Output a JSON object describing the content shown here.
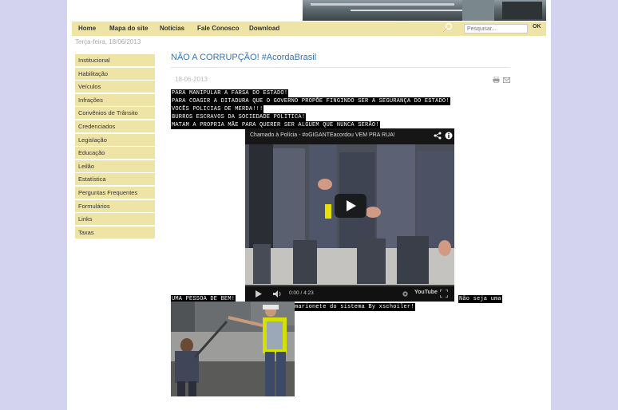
{
  "nav": {
    "items": [
      "Home",
      "Mapa do site",
      "Notícias",
      "Fale Conosco",
      "Download"
    ],
    "search_placeholder": "Pesquisar...",
    "ok_label": "OK"
  },
  "date_line": "Terça-feira, 18/06/2013",
  "sidebar": {
    "items": [
      "Institucional",
      "Habilitação",
      "Veículos",
      "Infrações",
      "Convênios de Trânsito",
      "Credenciados",
      "Legislação",
      "Educação",
      "Leilão",
      "Estatística",
      "Perguntas Frequentes",
      "Formulários",
      "Links",
      "Taxas"
    ]
  },
  "article": {
    "title": "NÃO A CORRUPÇÃO! #AcordaBrasil",
    "date": "18-06-2013",
    "lines": [
      "PARA MANIPULAR A FARSA DO ESTADO!",
      "PARA COAGIR A DITADURA QUE O GOVERNO PROPÕE FINGINDO SER A SEGURANÇA DO ESTADO!",
      "VOCÊS POLICIAS DE MERDA!!!",
      "BURROS ESCRAVOS DA SOCIEDADE POLITICA!",
      "MATAM A PROPRIA MÃE PARA QUERER SER ALGUEM QUE NUNCA SERÃO!"
    ],
    "line_after_video_left": "UMA PESSOA DE BEM!",
    "line_after_video_right": "Não seja uma",
    "line_after_video_2": "marionete do sistema By xschoiler!"
  },
  "video": {
    "title": "Chamado à Polícia - #oGIGANTEacordou VEM PRA RUA!",
    "time": "0:00 / 4:23",
    "youtube_label": "YouTube",
    "progress": 0
  },
  "colors": {
    "nav_bg": "#eee4a6",
    "title_blue": "#3a73b8",
    "page_bg": "#d3d3f0"
  }
}
